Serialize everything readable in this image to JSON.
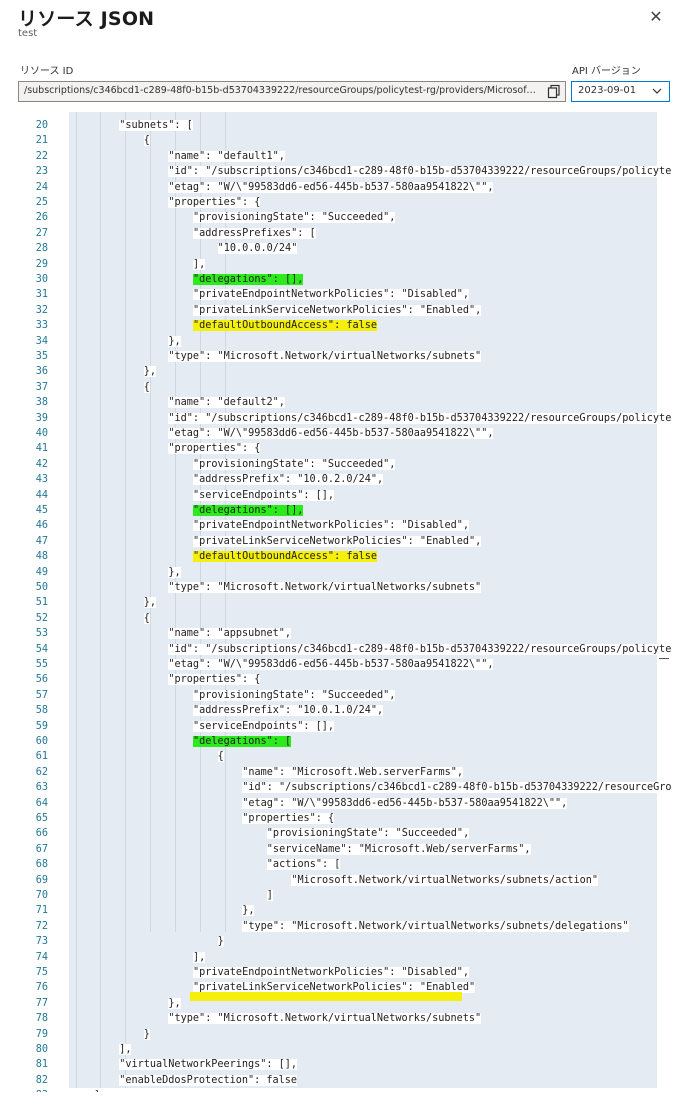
{
  "header": {
    "title": "リソース JSON",
    "subtitle": "test",
    "close_glyph": "✕"
  },
  "resource_id": {
    "label": "リソース ID",
    "value": "/subscriptions/c346bcd1-c289-48f0-b15b-d53704339222/resourceGroups/policytest-rg/providers/Microsoft...."
  },
  "api_version": {
    "label": "API バージョン",
    "selected": "2023-09-01"
  },
  "code": {
    "lines": [
      {
        "n": "20",
        "indent": 4,
        "text": "\"subnets\": ["
      },
      {
        "n": "21",
        "indent": 6,
        "text": "{"
      },
      {
        "n": "22",
        "indent": 8,
        "text": "\"name\": \"default1\","
      },
      {
        "n": "23",
        "indent": 8,
        "text": "\"id\": \"/subscriptions/c346bcd1-c289-48f0-b15b-d53704339222/resourceGroups/policyte"
      },
      {
        "n": "24",
        "indent": 8,
        "text": "\"etag\": \"W/\\\"99583dd6-ed56-445b-b537-580aa9541822\\\"\","
      },
      {
        "n": "25",
        "indent": 8,
        "text": "\"properties\": {"
      },
      {
        "n": "26",
        "indent": 10,
        "text": "\"provisioningState\": \"Succeeded\","
      },
      {
        "n": "27",
        "indent": 10,
        "text": "\"addressPrefixes\": ["
      },
      {
        "n": "28",
        "indent": 12,
        "text": "\"10.0.0.0/24\""
      },
      {
        "n": "29",
        "indent": 10,
        "text": "],"
      },
      {
        "n": "30",
        "indent": 10,
        "text": "\"delegations\": [],",
        "hl": "green"
      },
      {
        "n": "31",
        "indent": 10,
        "text": "\"privateEndpointNetworkPolicies\": \"Disabled\","
      },
      {
        "n": "32",
        "indent": 10,
        "text": "\"privateLinkServiceNetworkPolicies\": \"Enabled\","
      },
      {
        "n": "33",
        "indent": 10,
        "text": "\"defaultOutboundAccess\": false",
        "hl": "yellow"
      },
      {
        "n": "34",
        "indent": 8,
        "text": "},"
      },
      {
        "n": "35",
        "indent": 8,
        "text": "\"type\": \"Microsoft.Network/virtualNetworks/subnets\""
      },
      {
        "n": "36",
        "indent": 6,
        "text": "},"
      },
      {
        "n": "37",
        "indent": 6,
        "text": "{"
      },
      {
        "n": "38",
        "indent": 8,
        "text": "\"name\": \"default2\","
      },
      {
        "n": "39",
        "indent": 8,
        "text": "\"id\": \"/subscriptions/c346bcd1-c289-48f0-b15b-d53704339222/resourceGroups/policyte"
      },
      {
        "n": "40",
        "indent": 8,
        "text": "\"etag\": \"W/\\\"99583dd6-ed56-445b-b537-580aa9541822\\\"\","
      },
      {
        "n": "41",
        "indent": 8,
        "text": "\"properties\": {"
      },
      {
        "n": "42",
        "indent": 10,
        "text": "\"provisioningState\": \"Succeeded\","
      },
      {
        "n": "43",
        "indent": 10,
        "text": "\"addressPrefix\": \"10.0.2.0/24\","
      },
      {
        "n": "44",
        "indent": 10,
        "text": "\"serviceEndpoints\": [],"
      },
      {
        "n": "45",
        "indent": 10,
        "text": "\"delegations\": [],",
        "hl": "green"
      },
      {
        "n": "46",
        "indent": 10,
        "text": "\"privateEndpointNetworkPolicies\": \"Disabled\","
      },
      {
        "n": "47",
        "indent": 10,
        "text": "\"privateLinkServiceNetworkPolicies\": \"Enabled\","
      },
      {
        "n": "48",
        "indent": 10,
        "text": "\"defaultOutboundAccess\": false",
        "hl": "yellow"
      },
      {
        "n": "49",
        "indent": 8,
        "text": "},"
      },
      {
        "n": "50",
        "indent": 8,
        "text": "\"type\": \"Microsoft.Network/virtualNetworks/subnets\""
      },
      {
        "n": "51",
        "indent": 6,
        "text": "},"
      },
      {
        "n": "52",
        "indent": 6,
        "text": "{"
      },
      {
        "n": "53",
        "indent": 8,
        "text": "\"name\": \"appsubnet\","
      },
      {
        "n": "54",
        "indent": 8,
        "text": "\"id\": \"/subscriptions/c346bcd1-c289-48f0-b15b-d53704339222/resourceGroups/policyte"
      },
      {
        "n": "55",
        "indent": 8,
        "text": "\"etag\": \"W/\\\"99583dd6-ed56-445b-b537-580aa9541822\\\"\","
      },
      {
        "n": "56",
        "indent": 8,
        "text": "\"properties\": {"
      },
      {
        "n": "57",
        "indent": 10,
        "text": "\"provisioningState\": \"Succeeded\","
      },
      {
        "n": "58",
        "indent": 10,
        "text": "\"addressPrefix\": \"10.0.1.0/24\","
      },
      {
        "n": "59",
        "indent": 10,
        "text": "\"serviceEndpoints\": [],"
      },
      {
        "n": "60",
        "indent": 10,
        "text": "\"delegations\": [",
        "hl": "green"
      },
      {
        "n": "61",
        "indent": 12,
        "text": "{"
      },
      {
        "n": "62",
        "indent": 14,
        "text": "\"name\": \"Microsoft.Web.serverFarms\","
      },
      {
        "n": "63",
        "indent": 14,
        "text": "\"id\": \"/subscriptions/c346bcd1-c289-48f0-b15b-d53704339222/resourceGro"
      },
      {
        "n": "64",
        "indent": 14,
        "text": "\"etag\": \"W/\\\"99583dd6-ed56-445b-b537-580aa9541822\\\"\","
      },
      {
        "n": "65",
        "indent": 14,
        "text": "\"properties\": {"
      },
      {
        "n": "66",
        "indent": 16,
        "text": "\"provisioningState\": \"Succeeded\","
      },
      {
        "n": "67",
        "indent": 16,
        "text": "\"serviceName\": \"Microsoft.Web/serverFarms\","
      },
      {
        "n": "68",
        "indent": 16,
        "text": "\"actions\": ["
      },
      {
        "n": "69",
        "indent": 18,
        "text": "\"Microsoft.Network/virtualNetworks/subnets/action\""
      },
      {
        "n": "70",
        "indent": 16,
        "text": "]"
      },
      {
        "n": "71",
        "indent": 14,
        "text": "},"
      },
      {
        "n": "72",
        "indent": 14,
        "text": "\"type\": \"Microsoft.Network/virtualNetworks/subnets/delegations\""
      },
      {
        "n": "73",
        "indent": 12,
        "text": "}"
      },
      {
        "n": "74",
        "indent": 10,
        "text": "],"
      },
      {
        "n": "75",
        "indent": 10,
        "text": "\"privateEndpointNetworkPolicies\": \"Disabled\","
      },
      {
        "n": "76",
        "indent": 10,
        "text": "\"privateLinkServiceNetworkPolicies\": \"Enabled\""
      },
      {
        "n": "77",
        "indent": 8,
        "text": "},",
        "yellow_bar": true
      },
      {
        "n": "78",
        "indent": 8,
        "text": "\"type\": \"Microsoft.Network/virtualNetworks/subnets\""
      },
      {
        "n": "79",
        "indent": 6,
        "text": "}"
      },
      {
        "n": "80",
        "indent": 4,
        "text": "],"
      },
      {
        "n": "81",
        "indent": 4,
        "text": "\"virtualNetworkPeerings\": [],"
      },
      {
        "n": "82",
        "indent": 4,
        "text": "\"enableDdosProtection\": false"
      },
      {
        "n": "83",
        "indent": 2,
        "text": "}"
      }
    ]
  },
  "colors": {
    "highlight_green": "#2cea1c",
    "highlight_yellow": "#f4f00c",
    "line_number": "#237893"
  }
}
